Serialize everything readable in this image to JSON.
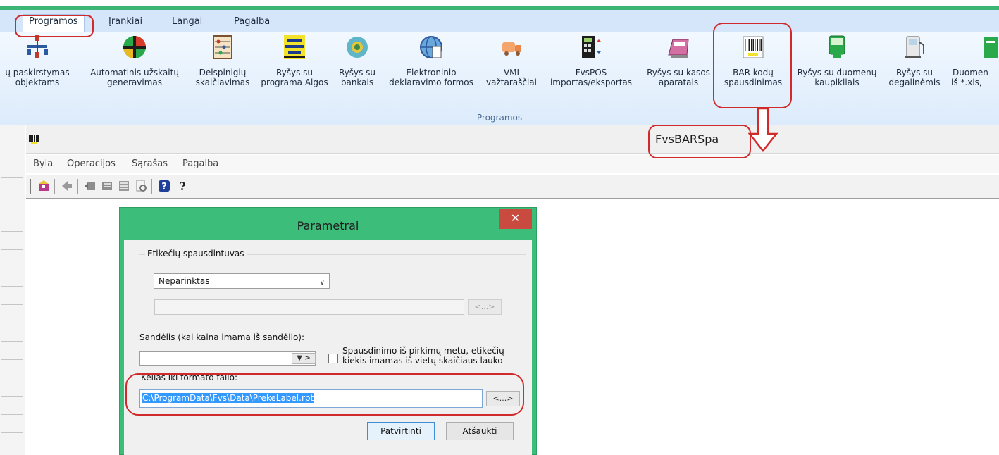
{
  "ribbon": {
    "tabs": [
      {
        "label": "Programos"
      },
      {
        "label": "Įrankiai"
      },
      {
        "label": "Langai"
      },
      {
        "label": "Pagalba"
      }
    ],
    "buttons": [
      {
        "line1": "ų paskirstymas",
        "line2": "objektams",
        "icon": "distribution-icon"
      },
      {
        "line1": "Automatinis užskaitų",
        "line2": "generavimas",
        "icon": "auto-offset-icon"
      },
      {
        "line1": "Delspinigių",
        "line2": "skaičiavimas",
        "icon": "abacus-icon"
      },
      {
        "line1": "Ryšys su",
        "line2": "programa Algos",
        "icon": "algos-icon"
      },
      {
        "line1": "Ryšys su",
        "line2": "bankais",
        "icon": "bank-icon"
      },
      {
        "line1": "Elektroninio",
        "line2": "deklaravimo formos",
        "icon": "globe-icon"
      },
      {
        "line1": "VMI",
        "line2": "važtaraščiai",
        "icon": "truck-icon"
      },
      {
        "line1": "FvsPOS",
        "line2": "importas/eksportas",
        "icon": "pos-icon"
      },
      {
        "line1": "Ryšys su kasos",
        "line2": "aparatais",
        "icon": "cash-register-icon"
      },
      {
        "line1": "BAR kodų",
        "line2": "spausdinimas",
        "icon": "barcode-icon"
      },
      {
        "line1": "Ryšys su duomenų",
        "line2": "kaupikliais",
        "icon": "data-collector-icon"
      },
      {
        "line1": "Ryšys su",
        "line2": "degalinėmis",
        "icon": "fuel-pump-icon"
      },
      {
        "line1": "Duomen",
        "line2": "iš *.xls,",
        "icon": "excel-icon"
      }
    ],
    "group_label": "Programos"
  },
  "document": {
    "title": "FvsBARSpa",
    "menu": [
      {
        "label": "Byla"
      },
      {
        "label": "Operacijos"
      },
      {
        "label": "Sąrašas"
      },
      {
        "label": "Pagalba"
      }
    ]
  },
  "dialog": {
    "title": "Parametrai",
    "close_label": "✕",
    "printer_group_label": "Etikečių spausdintuvas",
    "printer_value": "Neparinktas",
    "browse_label": "<...>",
    "warehouse_label": "Sandėlis (kai kaina imama iš sandėlio):",
    "warehouse_value": "",
    "warehouse_buttons": "▼ >",
    "checkbox_label_line1": "Spausdinimo iš pirkimų metu, etikečių",
    "checkbox_label_line2": "kiekis imamas iš vietų skaičiaus lauko",
    "path_label": "Kelias iki formato failo:",
    "path_value": "C:\\ProgramData\\Fvs\\Data\\PrekeLabel.rpt",
    "path_browse_label": "<...>",
    "confirm_label": "Patvirtinti",
    "cancel_label": "Atšaukti"
  },
  "colors": {
    "annotation": "#d12a2a",
    "dialog_frame": "#3dbd7a",
    "close_button": "#c94a3f"
  }
}
